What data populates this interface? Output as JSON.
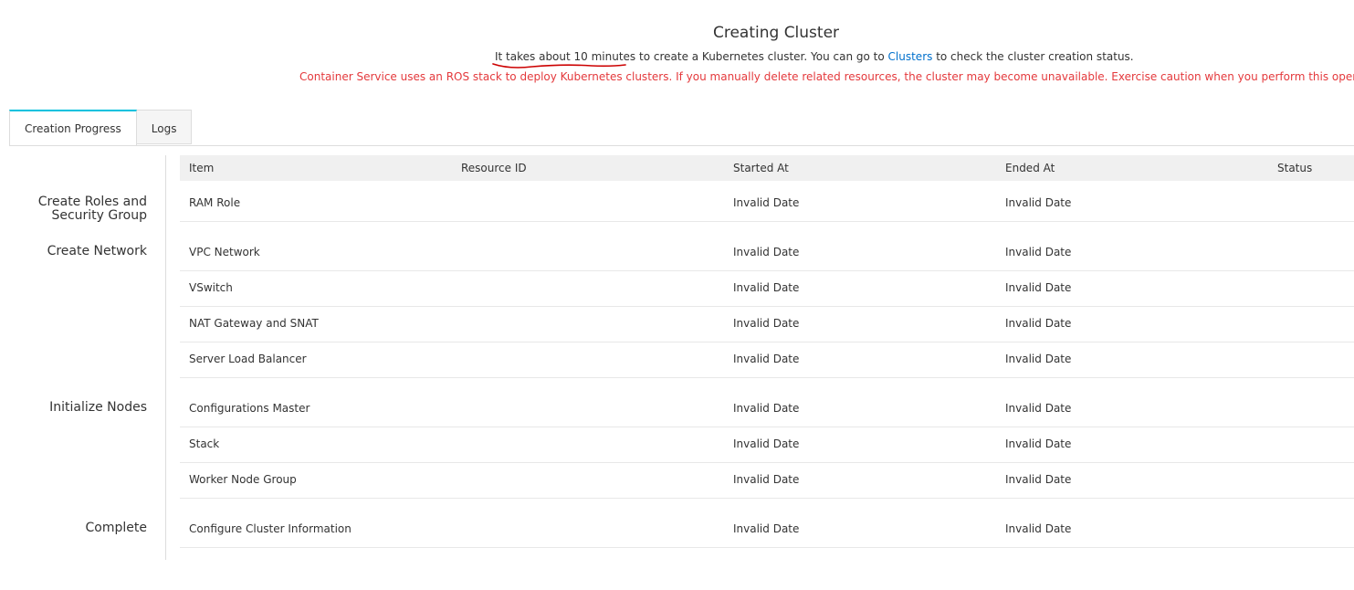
{
  "header": {
    "title": "Creating Cluster",
    "subtitle_part1": "It takes about 10 minutes to create a Kubernetes cluster. You can go to ",
    "subtitle_link": "Clusters",
    "subtitle_part2": " to check the cluster creation status.",
    "warning": "Container Service uses an ROS stack to deploy Kubernetes clusters. If you manually delete related resources, the cluster may become unavailable. Exercise caution when you perform this operation.",
    "annotation_color": "#cc0000"
  },
  "tabs": [
    {
      "label": "Creation Progress",
      "active": true
    },
    {
      "label": "Logs",
      "active": false
    }
  ],
  "table": {
    "headers": {
      "item": "Item",
      "resource_id": "Resource ID",
      "started_at": "Started At",
      "ended_at": "Ended At",
      "status": "Status"
    },
    "stages": [
      {
        "label_line1": "Create Roles and",
        "label_line2": "Security Group"
      },
      {
        "label_line1": "Create Network",
        "label_line2": ""
      },
      {
        "label_line1": "Initialize Nodes",
        "label_line2": ""
      },
      {
        "label_line1": "Complete",
        "label_line2": ""
      }
    ],
    "rows": [
      {
        "item": "RAM Role",
        "resource_id": "",
        "started_at": "Invalid Date",
        "ended_at": "Invalid Date",
        "status": ""
      },
      {
        "item": "VPC Network",
        "resource_id": "",
        "started_at": "Invalid Date",
        "ended_at": "Invalid Date",
        "status": ""
      },
      {
        "item": "VSwitch",
        "resource_id": "",
        "started_at": "Invalid Date",
        "ended_at": "Invalid Date",
        "status": ""
      },
      {
        "item": "NAT Gateway and SNAT",
        "resource_id": "",
        "started_at": "Invalid Date",
        "ended_at": "Invalid Date",
        "status": ""
      },
      {
        "item": "Server Load Balancer",
        "resource_id": "",
        "started_at": "Invalid Date",
        "ended_at": "Invalid Date",
        "status": ""
      },
      {
        "item": "Configurations Master",
        "resource_id": "",
        "started_at": "Invalid Date",
        "ended_at": "Invalid Date",
        "status": ""
      },
      {
        "item": "Stack",
        "resource_id": "",
        "started_at": "Invalid Date",
        "ended_at": "Invalid Date",
        "status": ""
      },
      {
        "item": "Worker Node Group",
        "resource_id": "",
        "started_at": "Invalid Date",
        "ended_at": "Invalid Date",
        "status": ""
      },
      {
        "item": "Configure Cluster Information",
        "resource_id": "",
        "started_at": "Invalid Date",
        "ended_at": "Invalid Date",
        "status": ""
      }
    ]
  }
}
